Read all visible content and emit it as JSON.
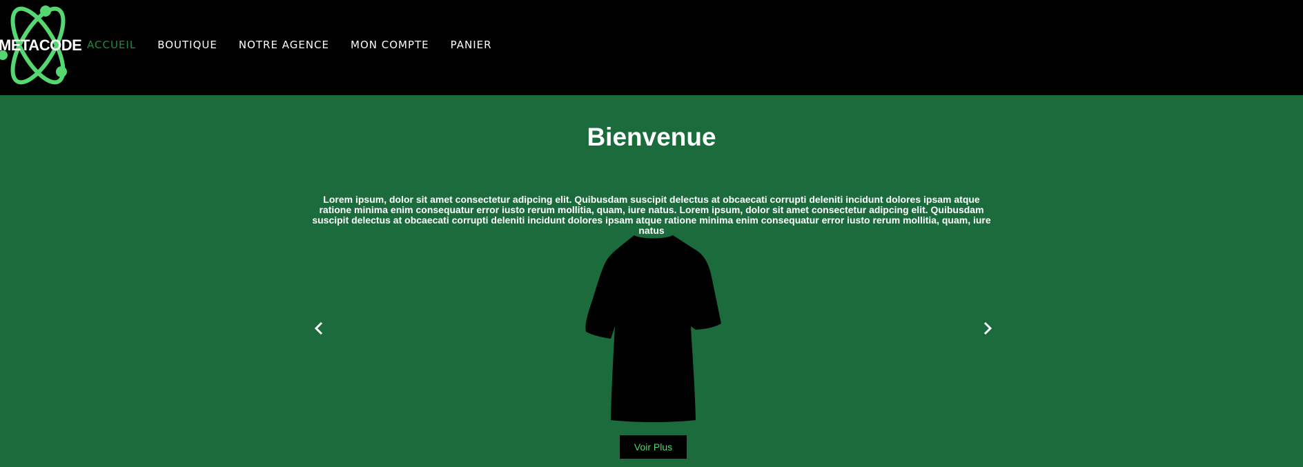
{
  "brand": {
    "name": "METACODE",
    "logo_icon": "atom-icon",
    "accent_color": "#55d872"
  },
  "nav": {
    "items": [
      {
        "label": "ACCUEIL",
        "active": true
      },
      {
        "label": "BOUTIQUE",
        "active": false
      },
      {
        "label": "NOTRE AGENCE",
        "active": false
      },
      {
        "label": "MON COMPTE",
        "active": false
      },
      {
        "label": "PANIER",
        "active": false
      }
    ]
  },
  "hero": {
    "title": "Bienvenue",
    "intro": "Lorem ipsum, dolor sit amet consectetur adipcing elit. Quibusdam suscipit delectus at obcaecati corrupti deleniti incidunt dolores ipsam atque ratione minima enim consequatur error iusto rerum mollitia, quam, iure natus. Lorem ipsum, dolor sit amet consectetur adipcing elit. Quibusdam suscipit delectus at obcaecati corrupti deleniti incidunt dolores ipsam atque ratione minima enim consequatur error iusto rerum mollitia, quam, iure natus",
    "carousel": {
      "prev_icon": "chevron-left-icon",
      "next_icon": "chevron-right-icon",
      "image": "t-shirt-icon"
    },
    "cta_label": "Voir Plus"
  },
  "colors": {
    "header_bg": "#000000",
    "main_bg": "#1c6b3c",
    "nav_active": "#1f8a45",
    "text": "#ffffff"
  }
}
